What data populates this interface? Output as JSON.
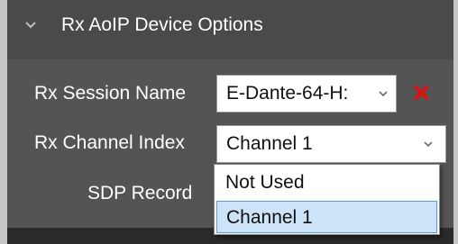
{
  "section": {
    "title": "Rx AoIP Device Options",
    "expand_icon": "chevron-down-icon"
  },
  "fields": {
    "session": {
      "label": "Rx Session Name",
      "value": "E-Dante-64-H:",
      "arrow_icon": "chevron-down-icon",
      "clear_icon": "close-icon",
      "clear_color": "#e01010"
    },
    "channel": {
      "label": "Rx Channel Index",
      "value": "Channel 1",
      "arrow_icon": "chevron-down-icon",
      "options": [
        "Not Used",
        "Channel 1"
      ],
      "selected_option": "Channel 1"
    },
    "sdp": {
      "label": "SDP Record"
    }
  },
  "colors": {
    "panel": "#545454",
    "header": "#4a4a4a",
    "highlight": "#cde3f7",
    "highlight_border": "#5a9ad6"
  }
}
